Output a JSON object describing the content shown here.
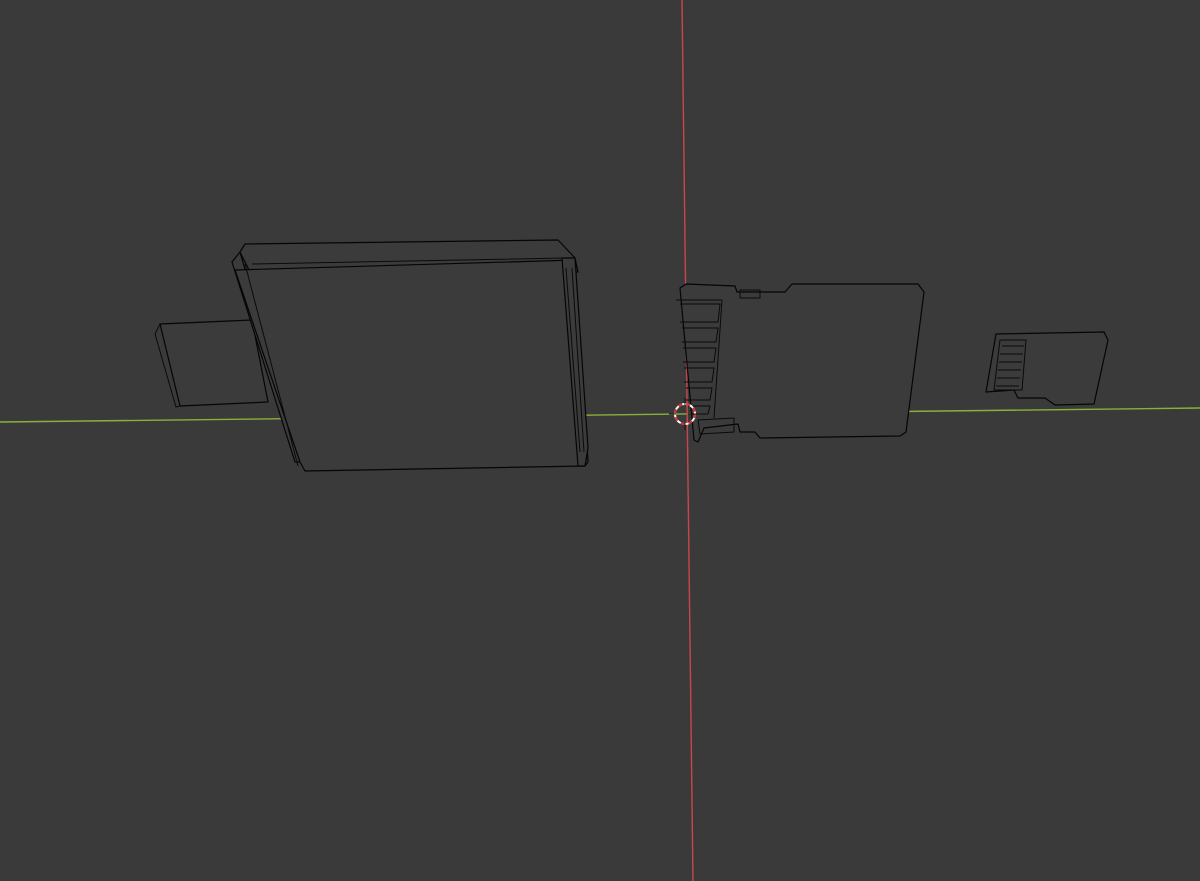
{
  "viewport": {
    "background": "#3a3a3a",
    "wire_color": "#050505",
    "axes": {
      "x_axis_color": "#8ab03a",
      "y_axis_color": "#c8474c"
    },
    "cursor_3d": {
      "icon": "3d-cursor-icon",
      "ring_colors": [
        "#ffffff",
        "#d62c2c"
      ]
    }
  },
  "objects": [
    {
      "name": "usb-card-reader",
      "display": "wireframe"
    },
    {
      "name": "sd-card-adapter",
      "display": "wireframe"
    },
    {
      "name": "microsd-card",
      "display": "wireframe"
    }
  ]
}
